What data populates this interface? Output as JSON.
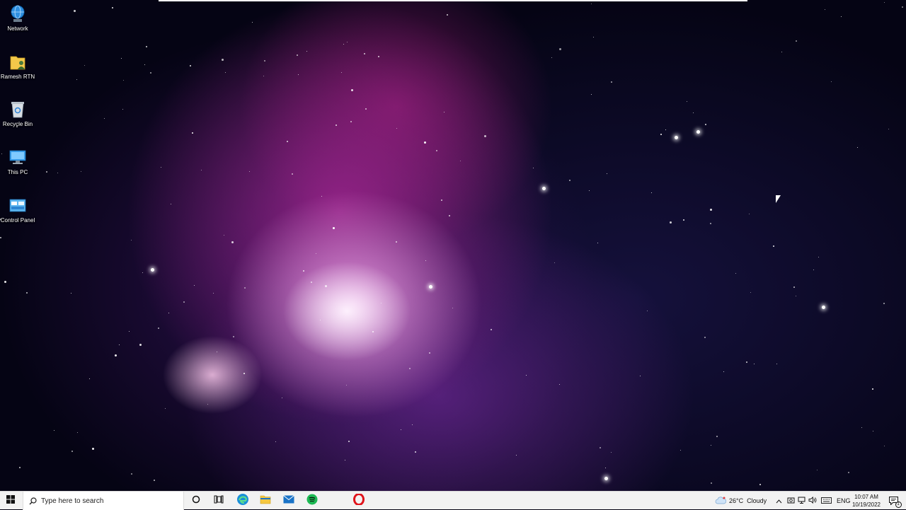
{
  "desktop": {
    "icons": [
      {
        "label": "Network",
        "icon": "network-icon"
      },
      {
        "label": "Ramesh RTN",
        "icon": "user-folder-icon"
      },
      {
        "label": "Recycle Bin",
        "icon": "recycle-bin-icon"
      },
      {
        "label": "This PC",
        "icon": "this-pc-icon"
      },
      {
        "label": "Control Panel",
        "icon": "control-panel-icon"
      }
    ]
  },
  "taskbar": {
    "search": {
      "placeholder": "Type here to search"
    },
    "pinned": [
      {
        "name": "cortana",
        "icon": "cortana-icon"
      },
      {
        "name": "task-view",
        "icon": "task-view-icon"
      },
      {
        "name": "edge",
        "icon": "edge-icon"
      },
      {
        "name": "file-explorer",
        "icon": "file-explorer-icon"
      },
      {
        "name": "mail",
        "icon": "mail-icon"
      },
      {
        "name": "spotify",
        "icon": "spotify-icon"
      },
      {
        "name": "opera",
        "icon": "opera-icon"
      }
    ],
    "weather": {
      "temp": "26°C",
      "condition": "Cloudy"
    },
    "tray": {
      "language": "ENG",
      "time": "10:07 AM",
      "date": "10/19/2022",
      "notification_count": "1"
    }
  },
  "colors": {
    "taskbar_bg": "#f2f2f2",
    "windows_blue": "#0078d7",
    "spotify_green": "#1db954",
    "opera_red": "#e0131b"
  }
}
